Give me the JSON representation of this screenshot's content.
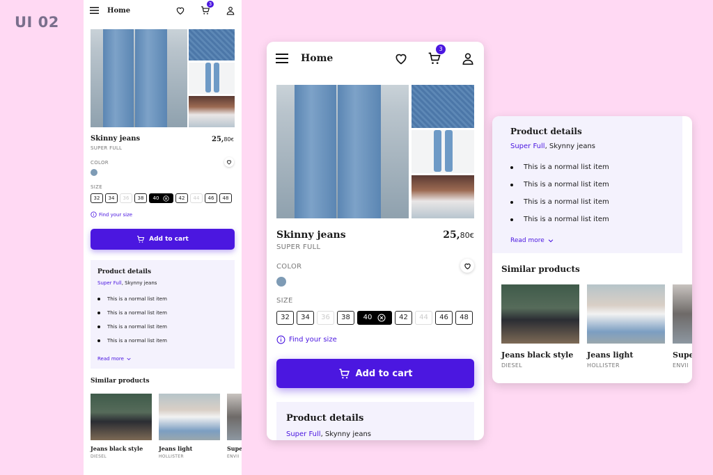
{
  "page_label": "UI 02",
  "header": {
    "title": "Home",
    "cart_count": "3"
  },
  "product": {
    "name": "Skinny jeans",
    "brand": "SUPER FULL",
    "price_int": "25,",
    "price_dec": "80",
    "currency": "€",
    "color_label": "COLOR",
    "color_swatch": "#7e9bb5",
    "size_label": "SIZE",
    "sizes": [
      {
        "label": "32",
        "state": "normal"
      },
      {
        "label": "34",
        "state": "normal"
      },
      {
        "label": "36",
        "state": "disabled"
      },
      {
        "label": "38",
        "state": "normal"
      },
      {
        "label": "40",
        "state": "selected"
      },
      {
        "label": "42",
        "state": "normal"
      },
      {
        "label": "44",
        "state": "disabled"
      },
      {
        "label": "46",
        "state": "normal"
      },
      {
        "label": "48",
        "state": "normal"
      }
    ],
    "find_size": "Find your size"
  },
  "cart_button": "Add to cart",
  "details": {
    "title": "Product details",
    "brand_link": "Super Full",
    "brand_rest": ", Skynny jeans",
    "items": [
      "This is a normal list item",
      "This is a normal list item",
      "This is a normal list item",
      "This is a normal list item"
    ],
    "read_more": "Read more"
  },
  "similar": {
    "title": "Similar products",
    "cards": [
      {
        "name": "Jeans black style",
        "brand": "DIESEL"
      },
      {
        "name": "Jeans light",
        "brand": "HOLLISTER"
      },
      {
        "name": "Super",
        "brand": "ENVII"
      }
    ]
  },
  "colors": {
    "accent": "#4b17e0",
    "background": "#ffd9f3"
  }
}
